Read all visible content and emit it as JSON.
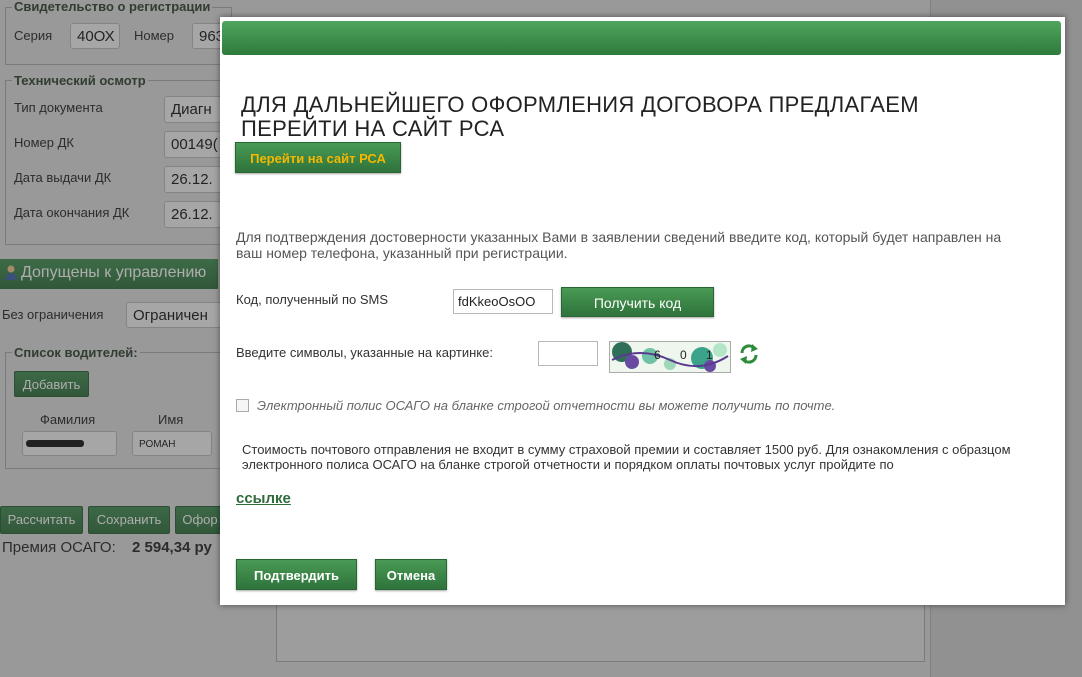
{
  "registration": {
    "legend": "Свидетельство о регистрации",
    "series_label": "Серия",
    "series_value": "40ОХ",
    "number_label": "Номер",
    "number_value": "963"
  },
  "inspection": {
    "legend": "Технический осмотр",
    "doc_type_label": "Тип документа",
    "doc_type_value": "Диагн",
    "dk_number_label": "Номер ДК",
    "dk_number_value": "00149(",
    "issue_date_label": "Дата выдачи ДК",
    "issue_date_value": "26.12.",
    "end_date_label": "Дата окончания ДК",
    "end_date_value": "26.12."
  },
  "drivers_section": {
    "title": "Допущены к управлению",
    "unlimited_label": "Без ограничения",
    "unlimited_value": "Ограничен",
    "list_legend": "Список водителей:",
    "add_button": "Добавить",
    "col_lastname": "Фамилия",
    "col_firstname": "Имя",
    "firstname_value": "РОМАН"
  },
  "bottom_actions": {
    "calculate": "Рассчитать",
    "save": "Сохранить",
    "issue": "Офор",
    "premium_label": "Премия ОСАГО:",
    "premium_value": "2 594,34 ру"
  },
  "modal": {
    "title": "ДЛЯ ДАЛЬНЕЙШЕГО ОФОРМЛЕНИЯ ДОГОВОРА ПРЕДЛАГАЕМ ПЕРЕЙТИ НА САЙТ РСА",
    "goto_rsa_button": "Перейти на сайт РСА",
    "confirm_text": "Для подтверждения достоверности указанных Вами в заявлении сведений введите код, который будет направлен на ваш номер телефона, указанный при регистрации.",
    "sms_label": "Код, полученный по SMS",
    "sms_value": "fdKkeoOsOO",
    "get_code_button": "Получить код",
    "captcha_label": "Введите символы, указанные на картинке:",
    "captcha_value": "",
    "captcha_chars": "6 0 1",
    "checkbox_label": "Электронный полис ОСАГО на бланке строгой отчетности вы можете получить по почте.",
    "postal_text": "Стоимость почтового отправления не входит в сумму страховой премии и составляет 1500 руб. Для ознакомления с образцом электронного полиса ОСАГО на бланке строгой отчетности и порядком оплаты почтовых услуг пройдите по",
    "link_text": "ссылке",
    "confirm_button": "Подтвердить",
    "cancel_button": "Отмена"
  },
  "colors": {
    "accent_green": "#2f7a3c",
    "button_text_orange": "#f5b800",
    "link_green": "#2d6b3a"
  },
  "icons": {
    "person": "person-icon",
    "refresh": "refresh-icon"
  }
}
